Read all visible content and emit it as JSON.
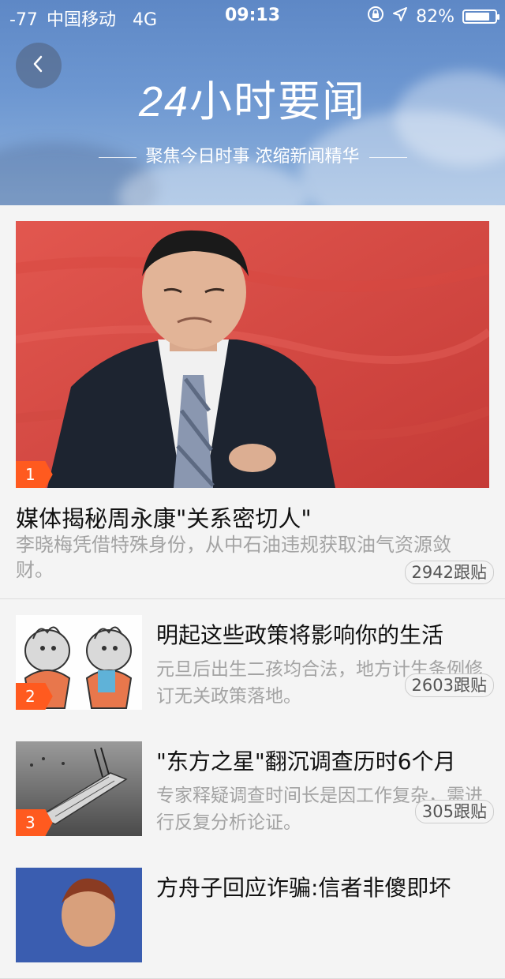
{
  "status_bar": {
    "signal": "-77",
    "carrier": "中国移动",
    "network": "4G",
    "time": "09:13",
    "battery": "82%",
    "battery_level": 0.82
  },
  "header": {
    "title_num": "24",
    "title_text": "小时要闻",
    "subtitle": "聚焦今日时事 浓缩新闻精华"
  },
  "feature": {
    "rank": "1",
    "title": "媒体揭秘周永康\"关系密切人\"",
    "desc": "李晓梅凭借特殊身份，从中石油违规获取油气资源敛财。",
    "comments": "2942跟贴"
  },
  "items": [
    {
      "rank": "2",
      "title": "明起这些政策将影响你的生活",
      "desc": "元旦后出生二孩均合法，地方计生条例修订无关政策落地。",
      "comments": "2603跟贴"
    },
    {
      "rank": "3",
      "title": "\"东方之星\"翻沉调查历时6个月",
      "desc": "专家释疑调查时间长是因工作复杂，需进行反复分析论证。",
      "comments": "305跟贴"
    },
    {
      "rank": "",
      "title": "方舟子回应诈骗:信者非傻即坏",
      "desc": "",
      "comments": ""
    }
  ],
  "colors": {
    "header_blue": "#6d97d1",
    "rank_orange": "#ff5a1f"
  }
}
